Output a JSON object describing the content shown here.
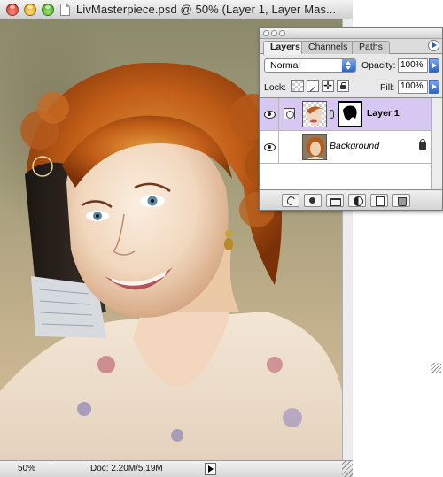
{
  "document_window": {
    "title": "LivMasterpiece.psd @ 50% (Layer 1, Layer Mas..."
  },
  "status_bar": {
    "zoom": "50%",
    "doc_info": "Doc: 2.20M/5.19M"
  },
  "layers_palette": {
    "tabs": [
      {
        "label": "Layers",
        "active": true
      },
      {
        "label": "Channels",
        "active": false
      },
      {
        "label": "Paths",
        "active": false
      }
    ],
    "blend_mode": "Normal",
    "opacity_label": "Opacity:",
    "opacity_value": "100%",
    "lock_label": "Lock:",
    "fill_label": "Fill:",
    "fill_value": "100%",
    "layers": [
      {
        "name": "Layer 1",
        "selected": true,
        "visible": true,
        "has_mask": true
      },
      {
        "name": "Background",
        "selected": false,
        "visible": true,
        "locked": true
      }
    ],
    "selected_color": "#d6c8f2"
  },
  "icons": {
    "window_controls": [
      "close-icon",
      "minimize-icon",
      "zoom-icon"
    ],
    "palette_buttons": [
      "layer-style-icon",
      "layer-mask-icon",
      "new-group-icon",
      "adjustment-layer-icon",
      "new-layer-icon",
      "trash-icon"
    ]
  }
}
